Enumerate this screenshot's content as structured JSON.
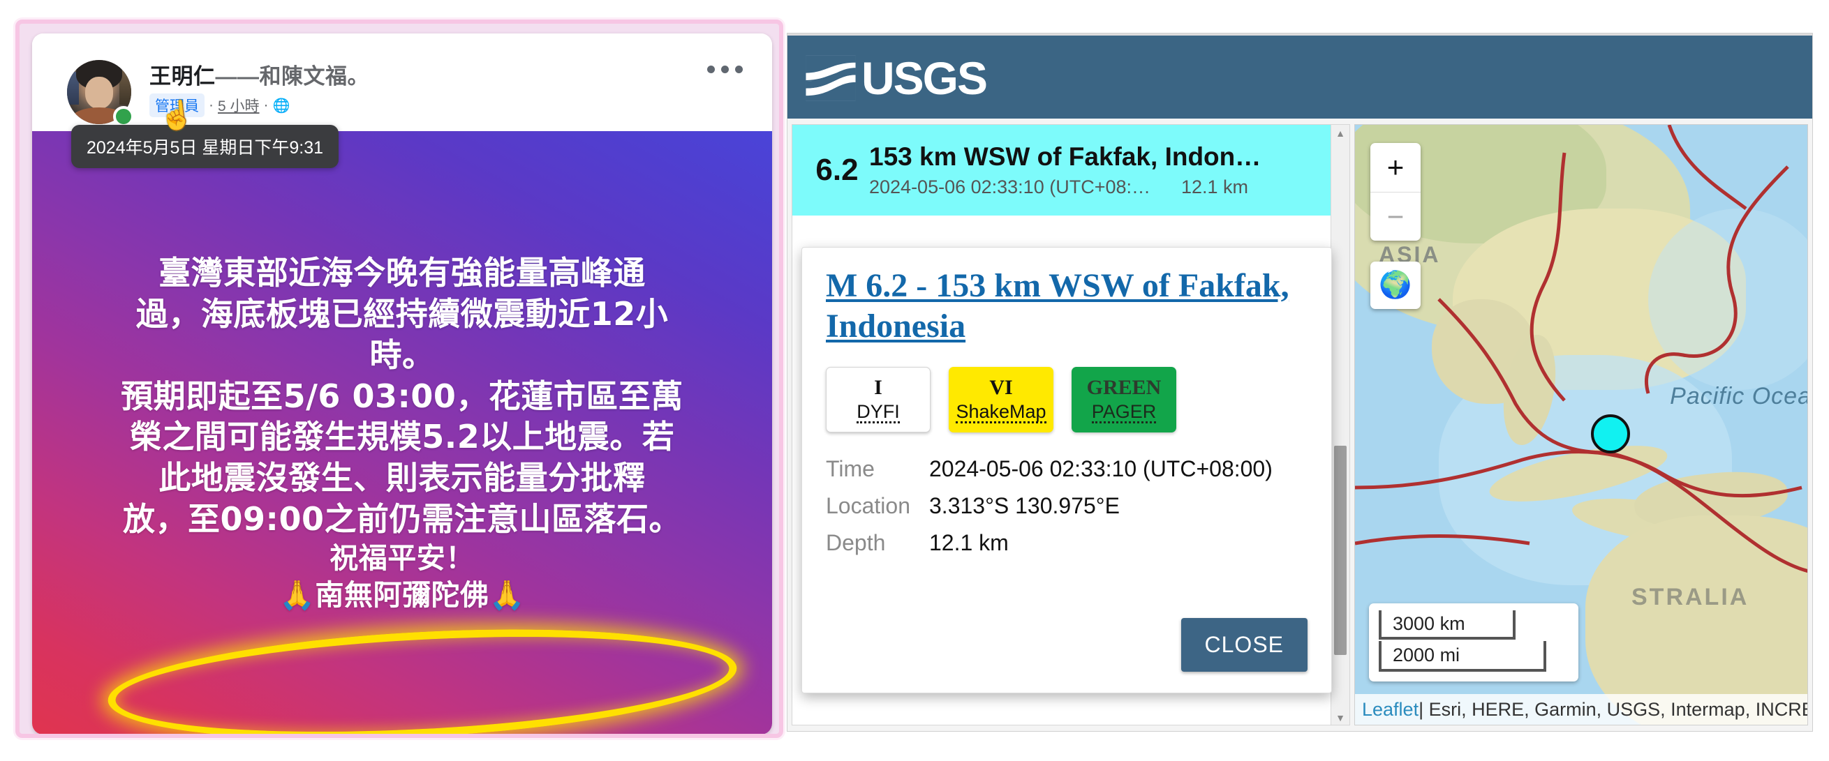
{
  "facebook": {
    "author": "王明仁",
    "author_with": "——和陳文福",
    "author_suffix": "。",
    "role_badge": "管理員",
    "separator": "·",
    "time_ago": "5 小時",
    "audience_icon": "globe-icon",
    "menu_icon": "ellipsis-icon",
    "tooltip": "2024年5月5日 星期日下午9:31",
    "cursor_icon": "pointing-hand-cursor",
    "post_lines": [
      "臺灣東部近海今晚有強能量高峰通",
      "過，海底板塊已經持續微震動近12小",
      "時。",
      "預期即起至5/6 03:00，花蓮市區至萬",
      "榮之間可能發生規模5.2以上地震。若",
      "此地震沒發生、則表示能量分批釋",
      "放，至09:00之前仍需注意山區落石。"
    ],
    "post_blessing": "祝福平安！",
    "post_chant": "🙏南無阿彌陀佛🙏",
    "highlight_color": "#ffe000"
  },
  "usgs": {
    "brand": "USGS",
    "brand_mark": "usgs-waves-logo",
    "list": {
      "items": [
        {
          "magnitude": "6.2",
          "title": "153 km WSW of Fakfak, Indon…",
          "time": "2024-05-06 02:33:10 (UTC+08:…",
          "depth": "12.1 km",
          "highlight_color": "#7dfbfb"
        }
      ],
      "scrollbar_up_icon": "caret-up-icon",
      "scrollbar_down_icon": "caret-down-icon"
    },
    "popup": {
      "title": "M 6.2 - 153 km WSW of Fakfak, Indonesia",
      "badges": [
        {
          "top": "I",
          "bottom": "DYFI",
          "bg": "#ffffff",
          "fg": "#111111"
        },
        {
          "top": "VI",
          "bottom": "ShakeMap",
          "bg": "#ffe900",
          "fg": "#111111"
        },
        {
          "top": "GREEN",
          "bottom": "PAGER",
          "bg": "#12a54a",
          "fg": "#1c2b1c"
        }
      ],
      "rows": [
        {
          "label": "Time",
          "value": "2024-05-06 02:33:10 (UTC+08:00)"
        },
        {
          "label": "Location",
          "value": "3.313°S 130.975°E"
        },
        {
          "label": "Depth",
          "value": "12.1 km"
        }
      ],
      "close_label": "CLOSE",
      "close_bg": "#3d6585"
    },
    "map": {
      "zoom_in_icon": "plus-icon",
      "zoom_in_label": "+",
      "zoom_out_icon": "minus-icon",
      "zoom_out_label": "−",
      "basemap_icon": "globe-icon",
      "basemap_glyph": "🌍",
      "labels": {
        "asia": "ASIA",
        "pacific": "Pacific Ocea",
        "australia": "STRALIA"
      },
      "scale_km": "3000 km",
      "scale_mi": "2000 mi",
      "marker_color": "#11f1f1",
      "attribution_link": "Leaflet",
      "attribution_rest": " | Esri, HERE, Garmin, USGS, Intermap, INCRE"
    }
  }
}
